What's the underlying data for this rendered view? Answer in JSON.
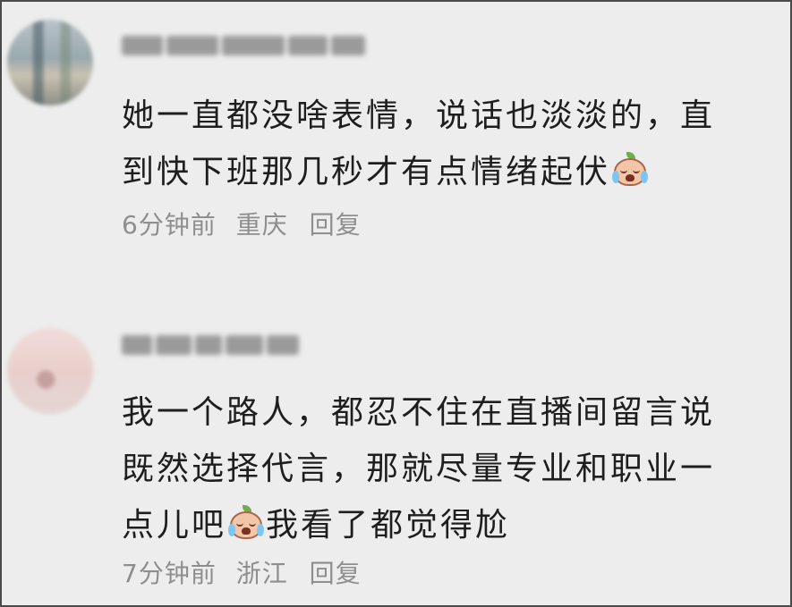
{
  "comments": [
    {
      "line1": "她一直都没啥表情，说话也淡淡的，直",
      "line2_pre": "到快下班那几秒才有点情绪起伏",
      "emoji": "crying-face-emoji",
      "time": "6分钟前",
      "location": "重庆",
      "reply": "回复"
    },
    {
      "line1": "我一个路人，都忍不住在直播间留言说",
      "line2": "既然选择代言，那就尽量专业和职业一",
      "line3_pre": "点儿吧",
      "emoji": "crying-face-emoji",
      "line3_post": "我看了都觉得尬",
      "time": "7分钟前",
      "location": "浙江",
      "reply": "回复"
    }
  ]
}
